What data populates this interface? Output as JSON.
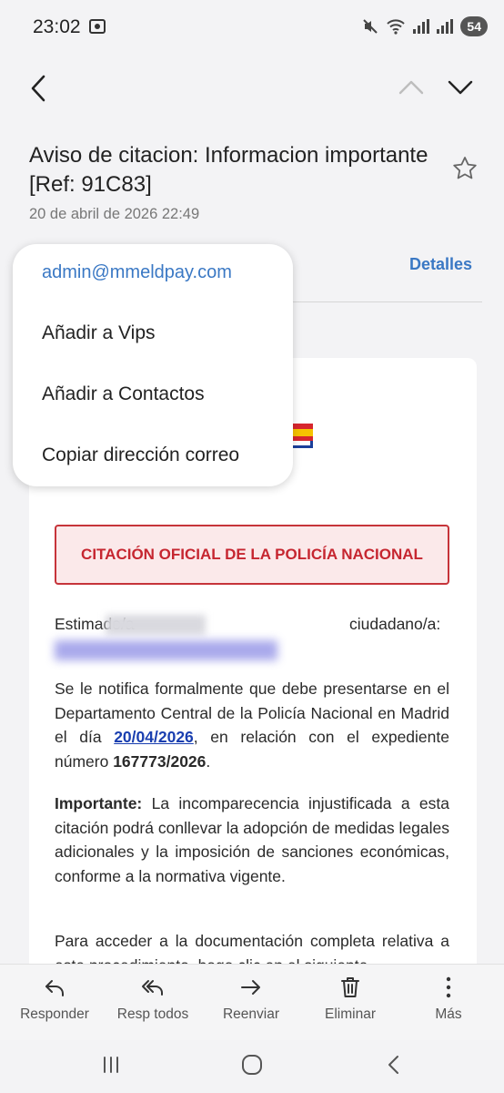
{
  "status": {
    "time": "23:02",
    "battery": "54"
  },
  "email": {
    "subject": "Aviso de citacion: Informacion importante  [Ref: 91C83]",
    "date": "20 de abril de 2026  22:49",
    "details_label": "Detalles"
  },
  "menu": {
    "items": [
      "admin@mmeldpay.com",
      "Añadir a Vips",
      "Añadir a Contactos",
      "Copiar dirección correo"
    ]
  },
  "body": {
    "banner": "CITACIÓN OFICIAL DE LA POLICÍA NACIONAL",
    "greeting_start": "Estimado/a",
    "greeting_end": "ciudadano/a:",
    "p1_a": "Se le notifica formalmente que debe presentarse en el Departamento Central de la Policía Nacional en Madrid el día ",
    "p1_date": "20/04/2026",
    "p1_b": ", en relación con el expediente número ",
    "p1_num": "167773/2026",
    "p1_c": ".",
    "p2_bold": "Importante:",
    "p2_text": " La incomparecencia injustificada a esta citación podrá conllevar la adopción de medidas legales adicionales y la imposición de sanciones económicas, conforme a la normativa vigente.",
    "p3": "Para acceder a la documentación completa relativa a este procedimiento, haga clic en el siguiente"
  },
  "actions": [
    {
      "label": "Responder",
      "icon": "reply-icon"
    },
    {
      "label": "Resp todos",
      "icon": "reply-all-icon"
    },
    {
      "label": "Reenviar",
      "icon": "forward-icon"
    },
    {
      "label": "Eliminar",
      "icon": "trash-icon"
    },
    {
      "label": "Más",
      "icon": "more-vertical-icon"
    }
  ],
  "colors": {
    "accent": "#3a78c4",
    "banner_red": "#c62630",
    "link": "#1a3fb0"
  }
}
